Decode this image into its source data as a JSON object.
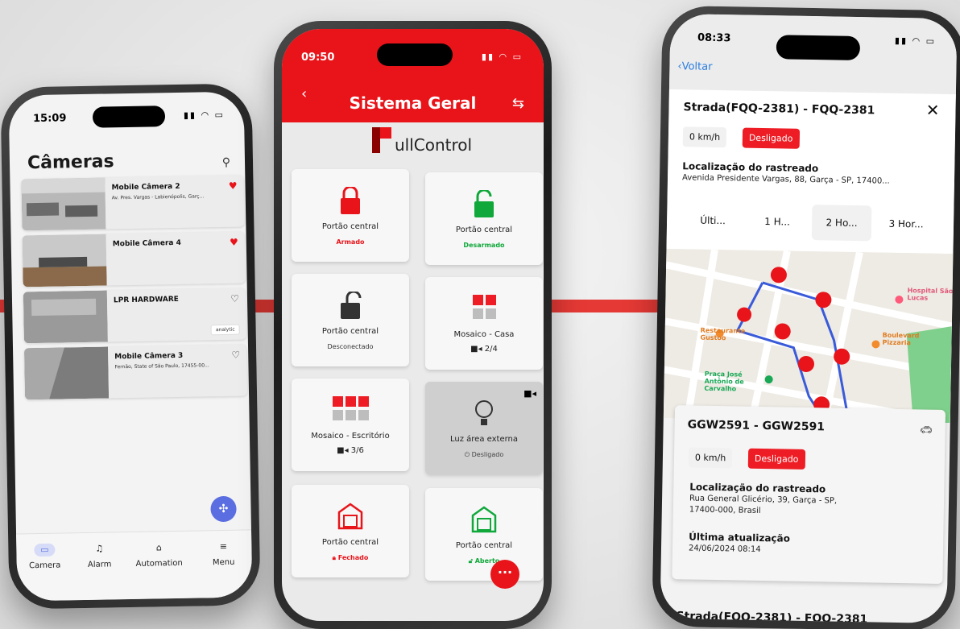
{
  "phone1": {
    "time": "15:09",
    "title": "Câmeras",
    "cameras": [
      {
        "name": "Mobile Câmera 2",
        "address": "Av. Pres. Vargas - Labienópolis, Garç...",
        "favorite": true
      },
      {
        "name": "Mobile Câmera 4",
        "address": "",
        "favorite": true
      },
      {
        "name": "LPR HARDWARE",
        "address": "",
        "favorite": false,
        "tag": "analytic"
      },
      {
        "name": "Mobile Câmera 3",
        "address": "Fernão, State of São Paulo, 17455-00...",
        "favorite": false
      }
    ],
    "nav": [
      {
        "label": "Camera",
        "icon": "camera-icon"
      },
      {
        "label": "Alarm",
        "icon": "bell-icon"
      },
      {
        "label": "Automation",
        "icon": "automation-icon"
      },
      {
        "label": "Menu",
        "icon": "menu-icon"
      }
    ]
  },
  "phone2": {
    "time": "09:50",
    "title": "Sistema Geral",
    "logo_text": "ullControl",
    "tiles": [
      {
        "label": "Portão central",
        "status": "Armado",
        "status_color": "#e8141a",
        "icon": "lock-closed-icon",
        "icon_color": "#e8141a"
      },
      {
        "label": "Portão central",
        "status": "Desarmado",
        "status_color": "#11a83b",
        "icon": "lock-open-icon",
        "icon_color": "#11a83b"
      },
      {
        "label": "Portão central",
        "status": "Desconectado",
        "status_color": "#333333",
        "icon": "lock-open-icon",
        "icon_color": "#333333"
      },
      {
        "label": "Mosaico - Casa",
        "count": "2/4",
        "icon": "mosaic-icon"
      },
      {
        "label": "Mosaico - Escritório",
        "count": "3/6",
        "icon": "mosaic-icon"
      },
      {
        "label": "Luz área externa",
        "status": "Desligado",
        "status_color": "#444444",
        "icon": "bulb-icon"
      },
      {
        "label": "Portão central",
        "status": "Fechado",
        "status_color": "#e8141a",
        "icon": "garage-icon",
        "icon_color": "#e8141a"
      },
      {
        "label": "Portão central",
        "status": "Aberto",
        "status_color": "#11a83b",
        "icon": "garage-icon",
        "icon_color": "#11a83b"
      }
    ]
  },
  "phone3": {
    "time": "08:33",
    "back_label": "Voltar",
    "vehicle": "Strada(FQQ-2381) - FQQ-2381",
    "speed": "0 km/h",
    "state": "Desligado",
    "location_title": "Localização do rastreado",
    "location_address": "Avenida Presidente Vargas, 88, Garça - SP, 17400...",
    "ranges": [
      "Últi...",
      "1 H...",
      "2 Ho...",
      "3 Hor..."
    ],
    "active_range": 2,
    "map_labels": [
      "Hospital São Lucas",
      "Restaurante Gustoo",
      "Boulevard Pizzaria",
      "Praça José Antônio de Carvalho"
    ],
    "card": {
      "vehicle": "GGW2591 - GGW2591",
      "speed": "0 km/h",
      "state": "Desligado",
      "location_title": "Localização do rastreado",
      "location_line1": "Rua General Glicério, 39, Garça - SP,",
      "location_line2": "17400-000, Brasil",
      "updated_title": "Última atualização",
      "updated_value": "24/06/2024 08:14"
    },
    "bottom_vehicle": "Strada(FQQ-2381) - FQQ-2381"
  },
  "colors": {
    "brand_red": "#e8141a",
    "green": "#11a83b",
    "accent_blue": "#5b6ee1",
    "route_blue": "#3a5bd9"
  }
}
